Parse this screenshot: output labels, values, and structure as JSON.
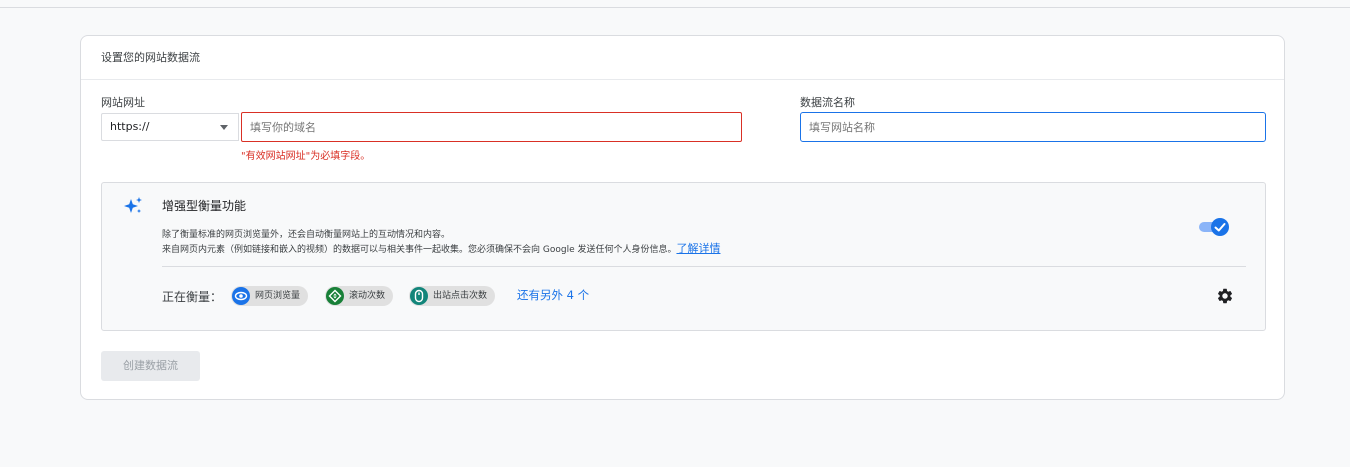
{
  "card": {
    "title": "设置您的网站数据流"
  },
  "url_field": {
    "label": "网站网址",
    "protocol_value": "https://",
    "placeholder": "填写你的域名",
    "error": "\"有效网站网址\"为必填字段。"
  },
  "name_field": {
    "label": "数据流名称",
    "placeholder": "填写网站名称"
  },
  "enhanced": {
    "title": "增强型衡量功能",
    "desc_line1": "除了衡量标准的网页浏览量外，还会自动衡量网站上的互动情况和内容。",
    "desc_line2": "来自网页内元素（例如链接和嵌入的视频）的数据可以与相关事件一起收集。您必须确保不会向 Google 发送任何个人身份信息。",
    "learn_more": "了解详情",
    "toggle_on": true,
    "measuring_label": "正在衡量：",
    "chips": [
      {
        "label": "网页浏览量",
        "icon": "eye-icon",
        "color": "#1a73e8"
      },
      {
        "label": "滚动次数",
        "icon": "scroll-icon",
        "color": "#188038"
      },
      {
        "label": "出站点击次数",
        "icon": "mouse-icon",
        "color": "#12857a"
      }
    ],
    "more": "还有另外 4 个"
  },
  "create_button": "创建数据流",
  "colors": {
    "accent": "#1a73e8",
    "error": "#d93025"
  }
}
